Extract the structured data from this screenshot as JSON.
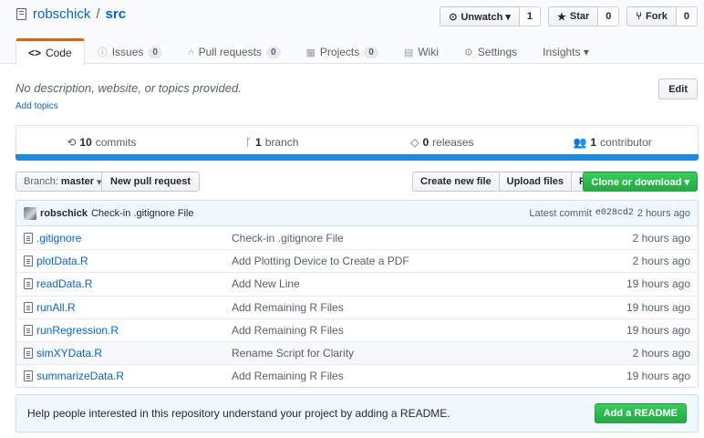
{
  "repo": {
    "owner": "robschick",
    "separator": "/",
    "name": "src"
  },
  "actions": {
    "watch_label": "Unwatch ▾",
    "watch_count": "1",
    "star_label": "Star",
    "star_count": "0",
    "fork_label": "Fork",
    "fork_count": "0"
  },
  "tabs": [
    {
      "label": "Code",
      "icon": "<>"
    },
    {
      "label": "Issues",
      "icon": "ⓘ",
      "count": "0"
    },
    {
      "label": "Pull requests",
      "icon": "⑃",
      "count": "0"
    },
    {
      "label": "Projects",
      "icon": "▦",
      "count": "0"
    },
    {
      "label": "Wiki",
      "icon": "▤"
    },
    {
      "label": "Settings",
      "icon": "⚙"
    },
    {
      "label": "Insights ▾"
    }
  ],
  "description": "No description, website, or topics provided.",
  "add_topics": "Add topics",
  "edit_label": "Edit",
  "summary": {
    "commits_count": "10",
    "commits_label": "commits",
    "branch_count": "1",
    "branch_label": "branch",
    "releases_count": "0",
    "releases_label": "releases",
    "contributor_count": "1",
    "contributor_label": "contributor"
  },
  "branch": {
    "prefix": "Branch:",
    "name": "master"
  },
  "new_pr": "New pull request",
  "file_buttons": [
    "Create new file",
    "Upload files",
    "Find file"
  ],
  "clone_label": "Clone or download ▾",
  "latest_commit": {
    "author": "robschick",
    "message": "Check-in .gitignore File",
    "prefix": "Latest commit",
    "sha": "e028cd2",
    "age": "2 hours ago"
  },
  "files": [
    {
      "name": ".gitignore",
      "message": "Check-in .gitignore File",
      "age": "2 hours ago"
    },
    {
      "name": "plotData.R",
      "message": "Add Plotting Device to Create a PDF",
      "age": "2 hours ago"
    },
    {
      "name": "readData.R",
      "message": "Add New Line",
      "age": "19 hours ago"
    },
    {
      "name": "runAll.R",
      "message": "Add Remaining R Files",
      "age": "19 hours ago"
    },
    {
      "name": "runRegression.R",
      "message": "Add Remaining R Files",
      "age": "19 hours ago"
    },
    {
      "name": "simXYData.R",
      "message": "Rename Script for Clarity",
      "age": "2 hours ago"
    },
    {
      "name": "summarizeData.R",
      "message": "Add Remaining R Files",
      "age": "19 hours ago"
    }
  ],
  "readme": {
    "message": "Help people interested in this repository understand your project by adding a README.",
    "button": "Add a README"
  },
  "colors": {
    "accent": "#0366d6",
    "green": "#28a745",
    "language_bar": "#198ce7",
    "tab_underline": "#e36209"
  }
}
